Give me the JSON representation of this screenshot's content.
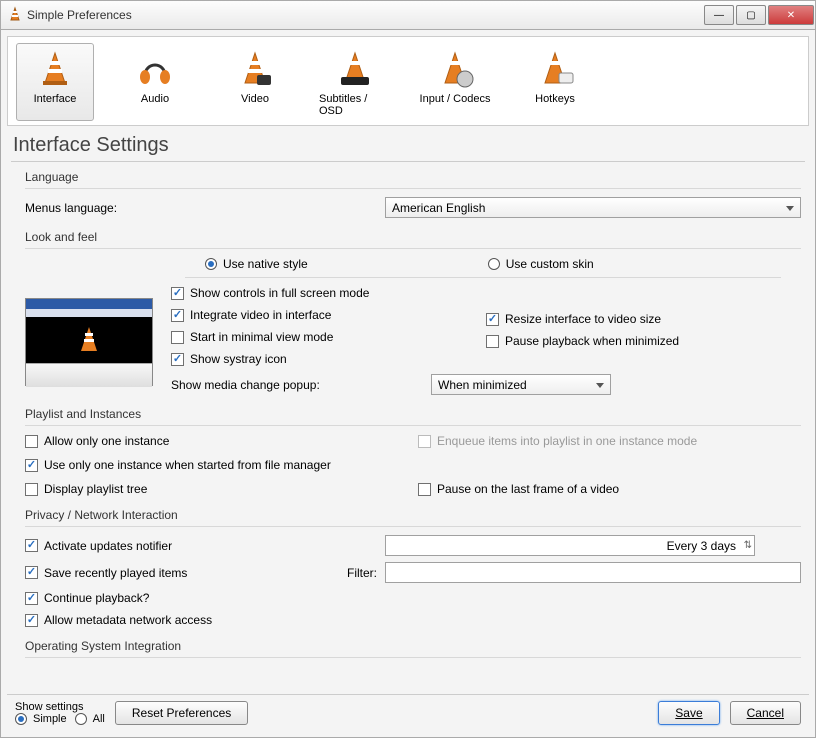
{
  "window": {
    "title": "Simple Preferences"
  },
  "categories": [
    {
      "label": "Interface",
      "active": true
    },
    {
      "label": "Audio"
    },
    {
      "label": "Video"
    },
    {
      "label": "Subtitles / OSD"
    },
    {
      "label": "Input / Codecs"
    },
    {
      "label": "Hotkeys"
    }
  ],
  "page": {
    "title": "Interface Settings"
  },
  "language": {
    "group_title": "Language",
    "menus_label": "Menus language:",
    "value": "American English"
  },
  "lookfeel": {
    "group_title": "Look and feel",
    "native_label": "Use native style",
    "custom_label": "Use custom skin",
    "native_selected": true,
    "show_controls": {
      "label": "Show controls in full screen mode",
      "checked": true
    },
    "integrate_video": {
      "label": "Integrate video in interface",
      "checked": true
    },
    "resize_interface": {
      "label": "Resize interface to video size",
      "checked": true
    },
    "start_minimal": {
      "label": "Start in minimal view mode",
      "checked": false
    },
    "pause_minimized": {
      "label": "Pause playback when minimized",
      "checked": false
    },
    "show_systray": {
      "label": "Show systray icon",
      "checked": true
    },
    "media_popup_label": "Show media change popup:",
    "media_popup_value": "When minimized"
  },
  "playlist": {
    "group_title": "Playlist and Instances",
    "allow_one": {
      "label": "Allow only one instance",
      "checked": false
    },
    "enqueue": {
      "label": "Enqueue items into playlist in one instance mode",
      "checked": false,
      "disabled": true
    },
    "use_one_fm": {
      "label": "Use only one instance when started from file manager",
      "checked": true
    },
    "display_tree": {
      "label": "Display playlist tree",
      "checked": false
    },
    "pause_last_frame": {
      "label": "Pause on the last frame of a video",
      "checked": false
    }
  },
  "privacy": {
    "group_title": "Privacy / Network Interaction",
    "updates": {
      "label": "Activate updates notifier",
      "checked": true
    },
    "updates_interval": "Every 3 days",
    "save_recent": {
      "label": "Save recently played items",
      "checked": true
    },
    "filter_label": "Filter:",
    "filter_value": "",
    "continue": {
      "label": "Continue playback?",
      "checked": true
    },
    "metadata": {
      "label": "Allow metadata network access",
      "checked": true
    }
  },
  "os_integration": {
    "group_title": "Operating System Integration"
  },
  "footer": {
    "show_settings_label": "Show settings",
    "simple_label": "Simple",
    "all_label": "All",
    "simple_selected": true,
    "reset": "Reset Preferences",
    "save": "Save",
    "cancel": "Cancel"
  }
}
